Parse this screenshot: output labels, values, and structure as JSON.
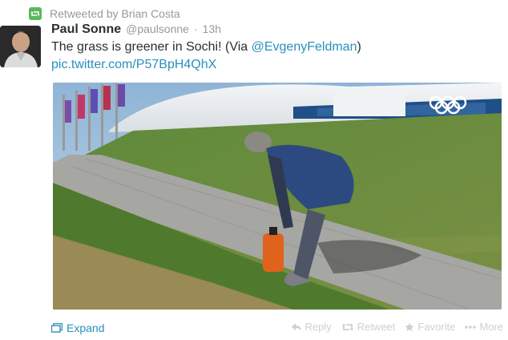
{
  "retweet": {
    "text": "Retweeted by Brian Costa",
    "icon": "retweet-icon"
  },
  "tweet": {
    "name": "Paul Sonne",
    "handle": "@paulsonne",
    "separator": "·",
    "time": "13h",
    "text_prefix": "The grass is greener in Sochi! (Via ",
    "mention": "@EvgenyFeldman",
    "text_suffix": ")",
    "link": "pic.twitter.com/P57BpH4QhX"
  },
  "footer": {
    "expand": "Expand",
    "reply": "Reply",
    "retweet": "Retweet",
    "favorite": "Favorite",
    "more": "More"
  },
  "colors": {
    "link": "#2a8fbd",
    "meta": "#999999",
    "retweet_badge": "#5cb85c",
    "action_inactive": "#cfcfcf"
  }
}
